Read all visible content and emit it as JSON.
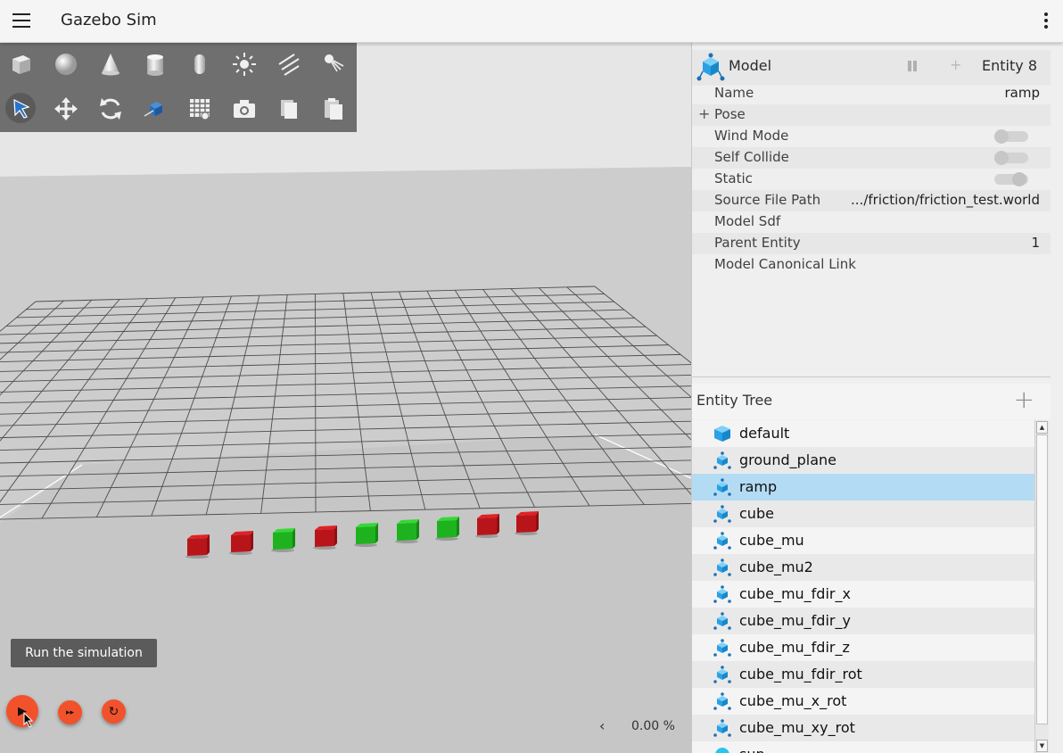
{
  "app": {
    "title": "Gazebo Sim"
  },
  "toolbar": {
    "shapes": [
      "box-icon",
      "sphere-icon",
      "cone-icon",
      "cylinder-icon",
      "capsule-icon",
      "point-light-icon",
      "directional-light-icon",
      "spot-light-icon"
    ],
    "tools": [
      "select-icon",
      "translate-icon",
      "rotate-icon",
      "transform-icon",
      "grid-snap-icon",
      "screenshot-icon",
      "copy-icon",
      "paste-icon"
    ]
  },
  "scene": {
    "boxes": [
      "red",
      "red",
      "green",
      "red",
      "green",
      "green",
      "green",
      "red",
      "red"
    ]
  },
  "controls": {
    "tooltip": "Run the simulation",
    "play_glyph": "▶",
    "step_glyph": "▸▸",
    "reset_glyph": "↻",
    "rtf_arrow": "‹",
    "rtf_value": "0.00 %"
  },
  "component_inspector": {
    "type_label": "Model",
    "entity_label": "Entity 8",
    "rows": [
      {
        "label": "Name",
        "value": "ramp"
      },
      {
        "label": "Pose",
        "value": ""
      },
      {
        "label": "Wind Mode",
        "value": ""
      },
      {
        "label": "Self Collide",
        "value": ""
      },
      {
        "label": "Static",
        "value": ""
      },
      {
        "label": "Source File Path",
        "value": ".../friction/friction_test.world"
      },
      {
        "label": "Model Sdf",
        "value": ""
      },
      {
        "label": "Parent Entity",
        "value": "1"
      },
      {
        "label": "Model Canonical Link",
        "value": ""
      }
    ],
    "toggles": {
      "wind_mode": false,
      "self_collide": false,
      "static": true
    }
  },
  "entity_tree": {
    "title": "Entity Tree",
    "add_glyph": "+",
    "selected": "ramp",
    "items": [
      {
        "label": "default",
        "icon": "world-icon"
      },
      {
        "label": "ground_plane",
        "icon": "model-icon"
      },
      {
        "label": "ramp",
        "icon": "model-icon"
      },
      {
        "label": "cube",
        "icon": "model-icon"
      },
      {
        "label": "cube_mu",
        "icon": "model-icon"
      },
      {
        "label": "cube_mu2",
        "icon": "model-icon"
      },
      {
        "label": "cube_mu_fdir_x",
        "icon": "model-icon"
      },
      {
        "label": "cube_mu_fdir_y",
        "icon": "model-icon"
      },
      {
        "label": "cube_mu_fdir_z",
        "icon": "model-icon"
      },
      {
        "label": "cube_mu_fdir_rot",
        "icon": "model-icon"
      },
      {
        "label": "cube_mu_x_rot",
        "icon": "model-icon"
      },
      {
        "label": "cube_mu_xy_rot",
        "icon": "model-icon"
      },
      {
        "label": "sun",
        "icon": "light-icon"
      }
    ]
  },
  "colors": {
    "accent": "#f2522b",
    "selection": "#b3dcf4",
    "model_icon": "#29a3e6",
    "red_box": "#c8161a",
    "green_box": "#1fc21f"
  }
}
